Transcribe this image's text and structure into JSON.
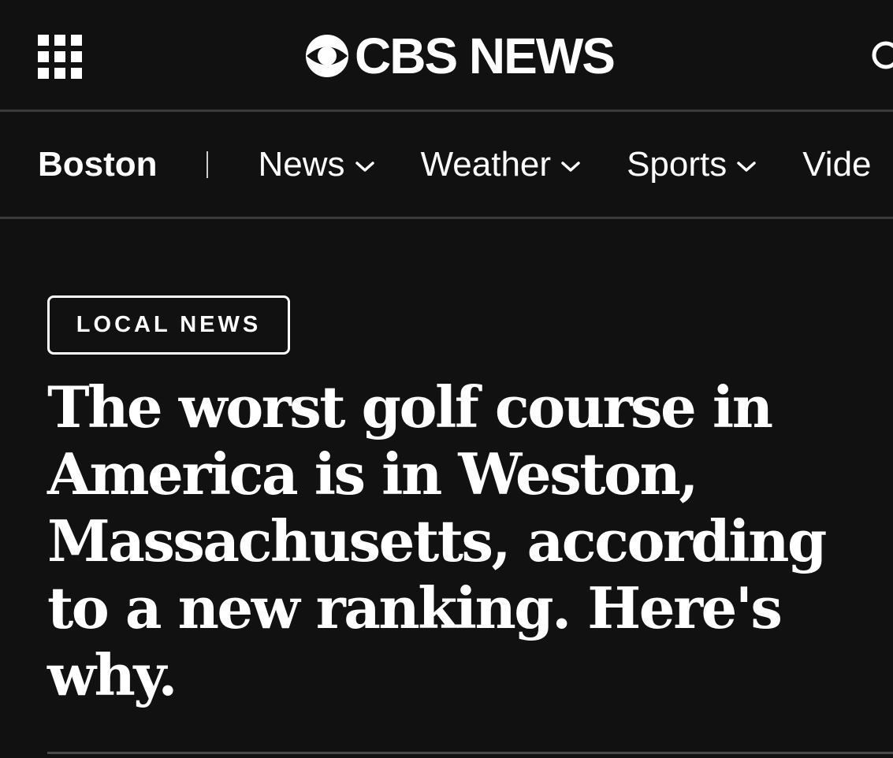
{
  "header": {
    "logo_text": "CBS NEWS"
  },
  "nav": {
    "city": "Boston",
    "separator": "|",
    "items": [
      {
        "label": "News"
      },
      {
        "label": "Weather"
      },
      {
        "label": "Sports"
      },
      {
        "label": "Vide"
      }
    ]
  },
  "article": {
    "category": "LOCAL NEWS",
    "headline": "The worst golf course in America is in Weston, Massachusetts, according to a new ranking. Here's why."
  },
  "colors": {
    "background": "#111111",
    "text": "#ffffff",
    "divider": "#3a3a3a"
  },
  "icons": [
    "grid-menu-icon",
    "cbs-eye-icon",
    "search-icon",
    "chevron-down-icon"
  ]
}
